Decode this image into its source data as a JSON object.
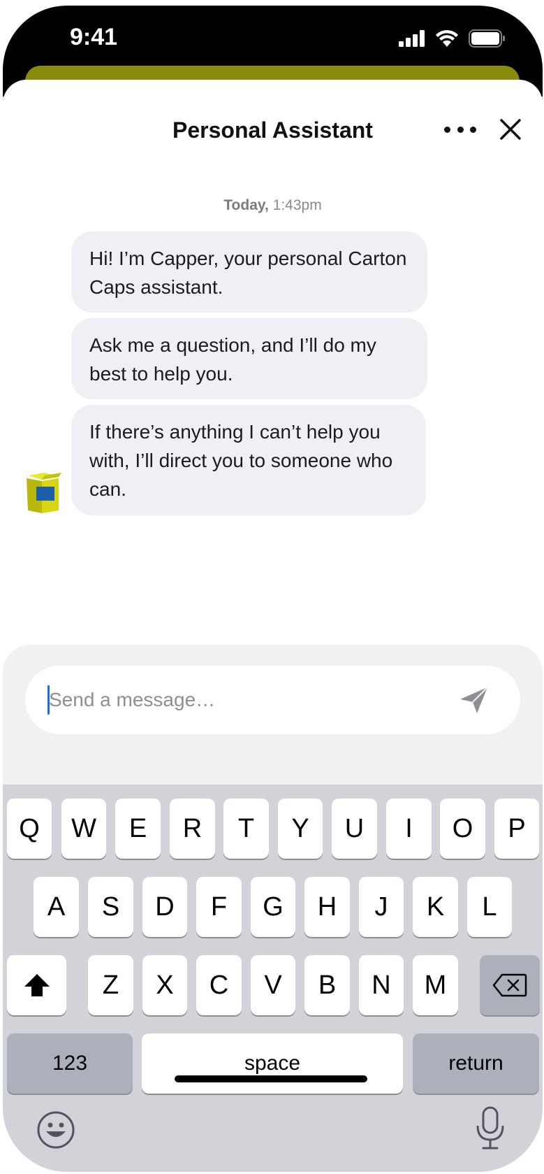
{
  "status_bar": {
    "time": "9:41",
    "icons": [
      "cellular-signal-icon",
      "wifi-icon",
      "battery-icon"
    ]
  },
  "header": {
    "title": "Personal Assistant",
    "more_icon": "more-horizontal-icon",
    "close_icon": "close-icon"
  },
  "chat": {
    "timestamp_day": "Today,",
    "timestamp_time": "1:43pm",
    "assistant_avatar": "carton-box-avatar-icon",
    "messages": [
      {
        "sender": "assistant",
        "text": "Hi! I’m Capper, your personal Carton Caps assistant."
      },
      {
        "sender": "assistant",
        "text": "Ask me a question, and I’ll do my best to help you."
      },
      {
        "sender": "assistant",
        "text": "If there’s anything I can’t help you with, I’ll direct you to someone who can."
      }
    ]
  },
  "composer": {
    "value": "",
    "placeholder": "Send a message…",
    "send_icon": "send-paper-plane-icon"
  },
  "keyboard": {
    "row1": [
      "Q",
      "W",
      "E",
      "R",
      "T",
      "Y",
      "U",
      "I",
      "O",
      "P"
    ],
    "row2": [
      "A",
      "S",
      "D",
      "F",
      "G",
      "H",
      "J",
      "K",
      "L"
    ],
    "row3": [
      "Z",
      "X",
      "C",
      "V",
      "B",
      "N",
      "M"
    ],
    "shift_icon": "shift-icon",
    "backspace_icon": "backspace-icon",
    "numbers_label": "123",
    "space_label": "space",
    "return_label": "return",
    "emoji_icon": "emoji-icon",
    "mic_icon": "microphone-icon"
  },
  "colors": {
    "accent_olive": "#8a8a0c",
    "bubble_bg": "#efeff4",
    "caret_blue": "#1a6fd8",
    "avatar_yellow": "#d8d611",
    "avatar_blue": "#1a5fa8"
  }
}
